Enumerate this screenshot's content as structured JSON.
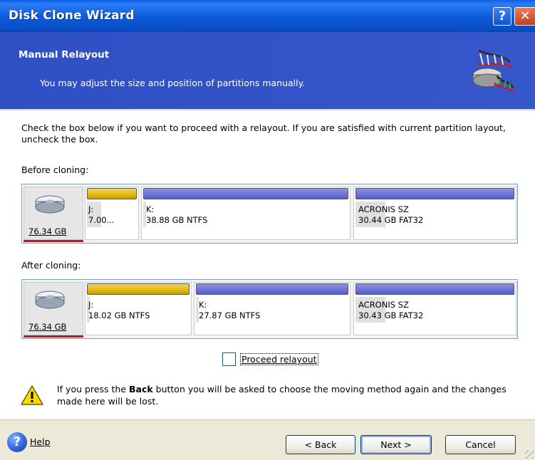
{
  "window": {
    "title": "Disk Clone Wizard",
    "help_glyph": "?",
    "close_glyph": "✕"
  },
  "banner": {
    "title": "Manual Relayout",
    "subtitle": "You may adjust the size and position of partitions manually.",
    "icon": "disk-clone-icon"
  },
  "content": {
    "instruction": "Check the box below if you want to proceed with a relayout. If you are satisfied with current partition layout, uncheck the box.",
    "before_label": "Before cloning:",
    "after_label": "After cloning:",
    "before": {
      "disk_size": "76.34 GB",
      "partitions": [
        {
          "line1": "J:",
          "line2": "7.00...",
          "bar_color": "#e2b80e"
        },
        {
          "line1": "K:",
          "line2": "38.88 GB  NTFS",
          "bar_color": "#6a72d6"
        },
        {
          "line1": "ACRONIS SZ",
          "line2": "30.44 GB  FAT32",
          "bar_color": "#6a72d6"
        }
      ]
    },
    "after": {
      "disk_size": "76.34 GB",
      "partitions": [
        {
          "line1": "J:",
          "line2": "18.02 GB  NTFS",
          "bar_color": "#e2b80e"
        },
        {
          "line1": "K:",
          "line2": "27.87 GB  NTFS",
          "bar_color": "#6a72d6"
        },
        {
          "line1": "ACRONIS SZ",
          "line2": "30.43 GB  FAT32",
          "bar_color": "#6a72d6"
        }
      ]
    },
    "checkbox": {
      "label": "Proceed relayout",
      "checked": false
    },
    "warning": {
      "prefix": "If you press the ",
      "bold": "Back",
      "suffix": " button you will be asked to choose the moving method again and the changes made here will be lost.",
      "icon": "warning-icon"
    }
  },
  "footer": {
    "help_label": "Help",
    "back_label": "< Back",
    "next_label": "Next >",
    "cancel_label": "Cancel"
  },
  "colors": {
    "titlebar": "#0c5ad8",
    "banner": "#2f52c8",
    "footer": "#ece9d8",
    "disk_underline": "#c8102e"
  }
}
